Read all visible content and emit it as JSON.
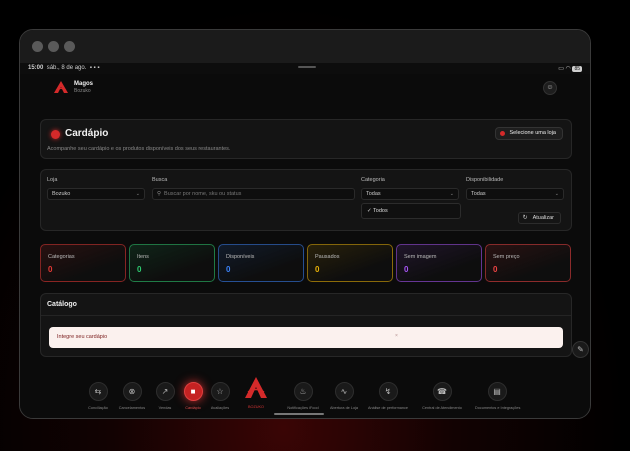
{
  "status": {
    "time": "15:00",
    "date": "sáb., 8 de ago.",
    "battery": "85"
  },
  "brand": {
    "name": "Magos",
    "sub": "Bozuko"
  },
  "hero": {
    "title": "Cardápio",
    "subtitle": "Acompanhe seu cardápio e os produtos disponíveis dos seus restaurantes.",
    "select_button": "Selecione uma loja"
  },
  "filters": {
    "loja": {
      "label": "Loja",
      "value": "Bozuko"
    },
    "busca": {
      "label": "Busca",
      "placeholder": "Buscar por nome, sku ou status"
    },
    "categoria": {
      "label": "Categoria",
      "value": "Todas",
      "dropdown_option": "Todos"
    },
    "disponibilidade": {
      "label": "Disponibilidade",
      "value": "Todas"
    },
    "refresh_label": "Atualizar"
  },
  "stats": [
    {
      "label": "Categorias",
      "value": "0",
      "color": "#e53935"
    },
    {
      "label": "Itens",
      "value": "0",
      "color": "#2ecc71"
    },
    {
      "label": "Disponíveis",
      "value": "0",
      "color": "#3b82f6"
    },
    {
      "label": "Pausados",
      "value": "0",
      "color": "#eab308"
    },
    {
      "label": "Sem imagem",
      "value": "0",
      "color": "#a855f7"
    },
    {
      "label": "Sem preço",
      "value": "0",
      "color": "#ef4444"
    }
  ],
  "catalog": {
    "title": "Catálogo",
    "alert": "Integre seu cardápio",
    "alert_mark": "×"
  },
  "dock": [
    {
      "label": "Conciliação",
      "icon": "arrows-icon"
    },
    {
      "label": "Cancelamentos",
      "icon": "cancel-icon"
    },
    {
      "label": "Vendas",
      "icon": "trend-icon"
    },
    {
      "label": "Cardápio",
      "icon": "menu-icon",
      "active": true
    },
    {
      "label": "Avaliações",
      "icon": "star-icon"
    },
    {
      "label": "Notificações iFood",
      "icon": "bell-icon"
    },
    {
      "label": "Abertura de Loja",
      "icon": "pulse-icon"
    },
    {
      "label": "Análise de performance",
      "icon": "bolt-icon"
    },
    {
      "label": "Central de Atendimento",
      "icon": "headset-icon"
    },
    {
      "label": "Documentos e Integrações",
      "icon": "document-icon"
    }
  ],
  "dock_brand": "BOZUKO",
  "colors": {
    "accent": "#d42a2a",
    "background": "#0b0b0b"
  }
}
